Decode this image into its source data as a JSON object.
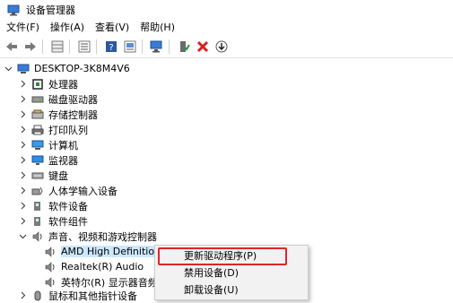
{
  "window": {
    "title": "设备管理器",
    "icon": "device-manager-icon"
  },
  "menu": [
    "文件(F)",
    "操作(A)",
    "查看(V)",
    "帮助(H)"
  ],
  "toolbar": {
    "icons": [
      "back-arrow-icon",
      "forward-arrow-icon",
      "properties-grid-icon",
      "view-list-icon",
      "help-icon",
      "monitor-list-icon",
      "scan-hardware-icon",
      "enable-device-icon",
      "remove-device-icon",
      "update-driver-icon"
    ]
  },
  "tree": {
    "root": "DESKTOP-3K8M4V6",
    "categories": [
      {
        "label": "处理器",
        "icon": "processor-icon"
      },
      {
        "label": "磁盘驱动器",
        "icon": "disk-drive-icon"
      },
      {
        "label": "存储控制器",
        "icon": "storage-controller-icon"
      },
      {
        "label": "打印队列",
        "icon": "printer-icon"
      },
      {
        "label": "计算机",
        "icon": "computer-icon"
      },
      {
        "label": "监视器",
        "icon": "monitor-icon"
      },
      {
        "label": "键盘",
        "icon": "keyboard-icon"
      },
      {
        "label": "人体学输入设备",
        "icon": "hid-icon"
      },
      {
        "label": "软件设备",
        "icon": "software-device-icon"
      },
      {
        "label": "软件组件",
        "icon": "software-component-icon"
      },
      {
        "label": "声音、视频和游戏控制器",
        "icon": "sound-icon"
      }
    ],
    "sound_children": [
      {
        "label": "AMD High Definition Audio Device",
        "icon": "speaker-icon"
      },
      {
        "label": "Realtek(R) Audio",
        "icon": "speaker-icon"
      },
      {
        "label": "英特尔(R) 显示器音频",
        "icon": "speaker-icon"
      }
    ],
    "last_partial": "鼠标和其他指针设备"
  },
  "context_menu": {
    "items": [
      "更新驱动程序(P)",
      "禁用设备(D)",
      "卸载设备(U)"
    ],
    "highlighted": "更新驱动程序(P)"
  },
  "colors": {
    "highlight_border": "#e0242a",
    "selection": "#cce8ff"
  }
}
